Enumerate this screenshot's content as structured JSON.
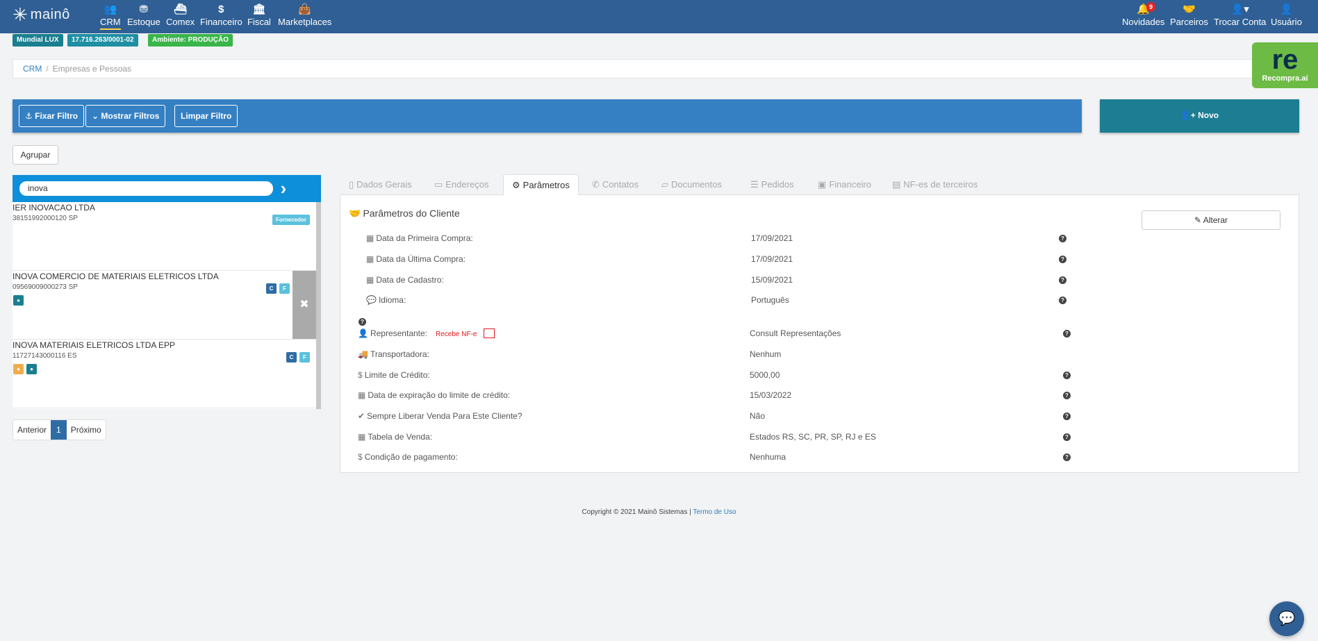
{
  "brand": {
    "logo_text": "mainô"
  },
  "nav": {
    "items": [
      {
        "label": "CRM",
        "icon": "users-icon"
      },
      {
        "label": "Estoque",
        "icon": "cubes-icon"
      },
      {
        "label": "Comex",
        "icon": "ship-icon"
      },
      {
        "label": "Financeiro",
        "icon": "dollar-icon"
      },
      {
        "label": "Fiscal",
        "icon": "bank-icon"
      },
      {
        "label": "Marketplaces",
        "icon": "shopping-bag-icon"
      }
    ],
    "right": [
      {
        "label": "Novidades",
        "icon": "bell-icon",
        "badge": "9"
      },
      {
        "label": "Parceiros",
        "icon": "handshake-icon"
      },
      {
        "label": "Trocar Conta",
        "icon": "user-switch-icon"
      },
      {
        "label": "Usuário",
        "icon": "user-icon"
      }
    ]
  },
  "tags": {
    "company": "Mundial LUX",
    "cnpj": "17.716.263/0001-02",
    "environment": "Ambiente: PRODUÇÃO"
  },
  "breadcrumb": {
    "root": "CRM",
    "separator": "/",
    "current": "Empresas e Pessoas"
  },
  "recompra": {
    "logo": "re",
    "name": "Recompra.aí"
  },
  "filters": {
    "fixar": "Fixar Filtro",
    "mostrar": "Mostrar Filtros",
    "limpar": "Limpar Filtro",
    "novo": "Novo",
    "agrupar": "Agrupar"
  },
  "search": {
    "value": "inova"
  },
  "list": [
    {
      "name": "IER INOVACAO LTDA",
      "doc": "38151992000120  SP",
      "badge": "Fornecedor"
    },
    {
      "name": "INOVA COMERCIO DE MATERIAIS ELETRICOS LTDA",
      "doc": "09569009000273  SP",
      "badge_c": "C",
      "badge_f": "F"
    },
    {
      "name": "INOVA MATERIAIS ELETRICOS LTDA EPP",
      "doc": "11727143000116  ES",
      "badge_c": "C",
      "badge_f": "F"
    }
  ],
  "pager": {
    "prev": "Anterior",
    "page": "1",
    "next": "Próximo"
  },
  "tabs": [
    {
      "label": "Dados Gerais"
    },
    {
      "label": "Endereços"
    },
    {
      "label": "Parâmetros"
    },
    {
      "label": "Contatos"
    },
    {
      "label": "Documentos"
    },
    {
      "label": "Pedidos"
    },
    {
      "label": "Financeiro"
    },
    {
      "label": "NF-es de terceiros"
    }
  ],
  "panel": {
    "title": "Parâmetros do Cliente",
    "alterar": "Alterar",
    "rows_top": [
      {
        "label": "Data da Primeira Compra:",
        "value": "17/09/2021"
      },
      {
        "label": "Data da Última Compra:",
        "value": "17/09/2021"
      },
      {
        "label": "Data de Cadastro:",
        "value": "15/09/2021"
      },
      {
        "label": "Idioma:",
        "value": "Português"
      }
    ],
    "rows_bottom": [
      {
        "label": "Representante:",
        "value": "Consult Representações",
        "extra": "Recebe NF-e"
      },
      {
        "label": "Transportadora:",
        "value": "Nenhum"
      },
      {
        "label": "Limite de Crédito:",
        "value": "5000,00"
      },
      {
        "label": "Data de expiração do limite de crédito:",
        "value": "15/03/2022"
      },
      {
        "label": "Sempre Liberar Venda Para Este Cliente?",
        "value": "Não"
      },
      {
        "label": "Tabela de Venda:",
        "value": "Estados RS, SC, PR, SP, RJ e ES"
      },
      {
        "label": "Condição de pagamento:",
        "value": "Nenhuma"
      }
    ]
  },
  "footer": {
    "copyright": "Copyright © 2021 Mainô Sistemas | ",
    "link": "Termo de Uso"
  },
  "colors": {
    "nav": "#2f5f94",
    "filterbar": "#3580c3",
    "novo": "#1c7d93",
    "search": "#0d8fd9",
    "recompra": "#6dbb45"
  }
}
